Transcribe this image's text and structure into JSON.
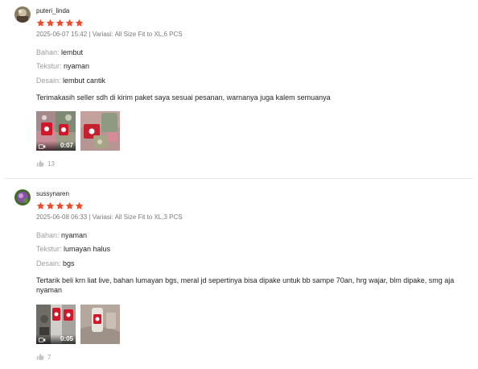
{
  "colors": {
    "star": "#ee4d2d",
    "attr_key": "#9e9e9e",
    "meta": "#757575"
  },
  "reviews": [
    {
      "username": "puteri_linda",
      "rating": 5,
      "date": "2025-06-07 15:42",
      "variant": "Variasi: All Size Fit to XL,6 PCS",
      "attributes": [
        {
          "key": "Bahan:",
          "value": "lembut"
        },
        {
          "key": "Tekstur:",
          "value": "nyaman"
        },
        {
          "key": "Desain:",
          "value": "lembut cantik"
        }
      ],
      "comment": "Terimakasih seller sdh di kirim paket saya sesuai pesanan, warnanya juga kalem semuanya",
      "video_duration": "0:07",
      "likes": "13",
      "icons": {
        "like": "thumbs-up-icon",
        "video": "video-camera-icon"
      }
    },
    {
      "username": "sussynaren",
      "rating": 5,
      "date": "2025-06-08 06:33",
      "variant": "Variasi: All Size Fit to XL,3 PCS",
      "attributes": [
        {
          "key": "Bahan:",
          "value": "nyaman"
        },
        {
          "key": "Tekstur:",
          "value": "lumayan halus"
        },
        {
          "key": "Desain:",
          "value": "bgs"
        }
      ],
      "comment": "Tertarik beli krn liat live, bahan lumayan bgs, meral jd sepertinya bisa dipake untuk bb sampe 70an, hrg wajar, blm dipake, smg aja nyaman",
      "video_duration": "0:05",
      "likes": "7",
      "icons": {
        "like": "thumbs-up-icon",
        "video": "video-camera-icon"
      }
    }
  ]
}
